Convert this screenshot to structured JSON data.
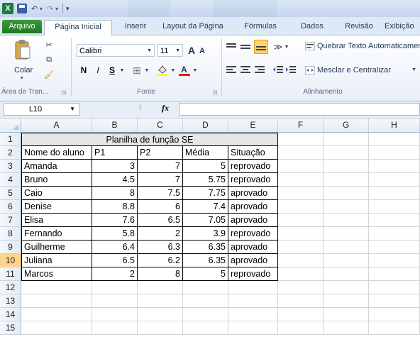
{
  "quick_access": {
    "excel_glyph": "X",
    "undo_glyph": "↶",
    "redo_glyph": "↷",
    "dd": "▾"
  },
  "tabs": [
    "Arquivo",
    "Página Inicial",
    "Inserir",
    "Layout da Página",
    "Fórmulas",
    "Dados",
    "Revisão",
    "Exibição"
  ],
  "ribbon": {
    "clipboard": {
      "paste": "Colar",
      "group": "Área de Tran...",
      "launcher": "⊡"
    },
    "font": {
      "name": "Calibri",
      "size": "11",
      "grow": "A",
      "shrink": "A",
      "bold": "N",
      "italic": "I",
      "underline": "S",
      "group": "Fonte",
      "launcher": "⊡"
    },
    "alignment": {
      "wrap": "Quebrar Texto Automaticamente",
      "merge": "Mesclar e Centralizar",
      "group": "Alinhamento"
    }
  },
  "formula_bar": {
    "name_box": "L10",
    "fx": "fx",
    "value": ""
  },
  "grid": {
    "columns": [
      "A",
      "B",
      "C",
      "D",
      "E",
      "F",
      "G",
      "H"
    ],
    "rows": [
      "1",
      "2",
      "3",
      "4",
      "5",
      "6",
      "7",
      "8",
      "9",
      "10",
      "11",
      "12",
      "13",
      "14",
      "15"
    ],
    "selected_row": "10",
    "title": "Planilha de função SE",
    "headers": [
      "Nome do aluno",
      "P1",
      "P2",
      "Média",
      "Situação"
    ],
    "data": [
      [
        "Amanda",
        "3",
        "7",
        "5",
        "reprovado"
      ],
      [
        "Bruno",
        "4.5",
        "7",
        "5.75",
        "reprovado"
      ],
      [
        "Caio",
        "8",
        "7.5",
        "7.75",
        "aprovado"
      ],
      [
        "Denise",
        "8.8",
        "6",
        "7.4",
        "aprovado"
      ],
      [
        "Elisa",
        "7.6",
        "6.5",
        "7.05",
        "aprovado"
      ],
      [
        "Fernando",
        "5.8",
        "2",
        "3.9",
        "reprovado"
      ],
      [
        "Guilherme",
        "6.4",
        "6.3",
        "6.35",
        "aprovado"
      ],
      [
        "Juliana",
        "6.5",
        "6.2",
        "6.35",
        "aprovado"
      ],
      [
        "Marcos",
        "2",
        "8",
        "5",
        "reprovado"
      ]
    ]
  },
  "colors": {
    "file_tab": "#1e7a1e",
    "selected_row_header": "#ffd58d",
    "title_fill": "#e6e6e6"
  }
}
